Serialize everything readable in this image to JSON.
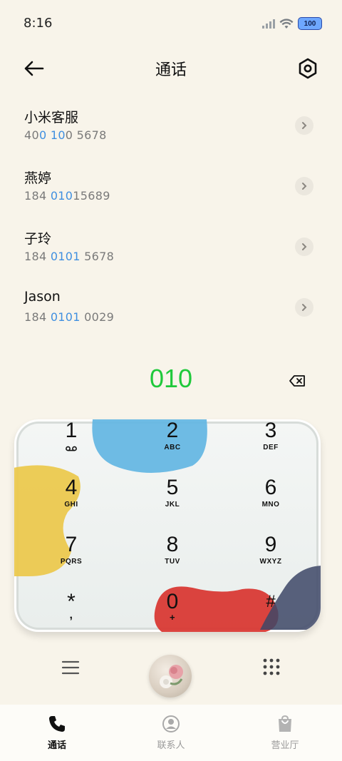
{
  "status_bar": {
    "time": "8:16",
    "battery": "100"
  },
  "header": {
    "title": "通话"
  },
  "contacts": [
    {
      "name": "小米客服",
      "number": [
        {
          "t": "40",
          "hl": false
        },
        {
          "t": "0 10",
          "hl": true
        },
        {
          "t": "0 5678",
          "hl": false
        }
      ]
    },
    {
      "name": "燕婷",
      "number": [
        {
          "t": "184 ",
          "hl": false
        },
        {
          "t": "010",
          "hl": true
        },
        {
          "t": "15689",
          "hl": false
        }
      ]
    },
    {
      "name": "子玲",
      "number": [
        {
          "t": "184 ",
          "hl": false
        },
        {
          "t": "0101",
          "hl": true
        },
        {
          "t": " 5678",
          "hl": false
        }
      ]
    },
    {
      "name": "Jason",
      "number": [
        {
          "t": "184 ",
          "hl": false
        },
        {
          "t": "0101",
          "hl": true
        },
        {
          "t": " 0029",
          "hl": false
        }
      ]
    }
  ],
  "dial": {
    "value": "010"
  },
  "keypad": {
    "keys": [
      {
        "digit": "1",
        "letters": ""
      },
      {
        "digit": "2",
        "letters": "ABC"
      },
      {
        "digit": "3",
        "letters": "DEF"
      },
      {
        "digit": "4",
        "letters": "GHI"
      },
      {
        "digit": "5",
        "letters": "JKL"
      },
      {
        "digit": "6",
        "letters": "MNO"
      },
      {
        "digit": "7",
        "letters": "PQRS"
      },
      {
        "digit": "8",
        "letters": "TUV"
      },
      {
        "digit": "9",
        "letters": "WXYZ"
      },
      {
        "digit": "*",
        "letters": ","
      },
      {
        "digit": "0",
        "letters": "+"
      },
      {
        "digit": "#",
        "letters": ""
      }
    ]
  },
  "tabs": [
    {
      "label": "通话",
      "icon": "phone-icon",
      "active": true
    },
    {
      "label": "联系人",
      "icon": "contact-icon",
      "active": false
    },
    {
      "label": "营业厅",
      "icon": "store-icon",
      "active": false
    }
  ],
  "colors": {
    "accent_green": "#1fc93b",
    "highlight_blue": "#3f8fe0",
    "background": "#f8f4ea"
  }
}
